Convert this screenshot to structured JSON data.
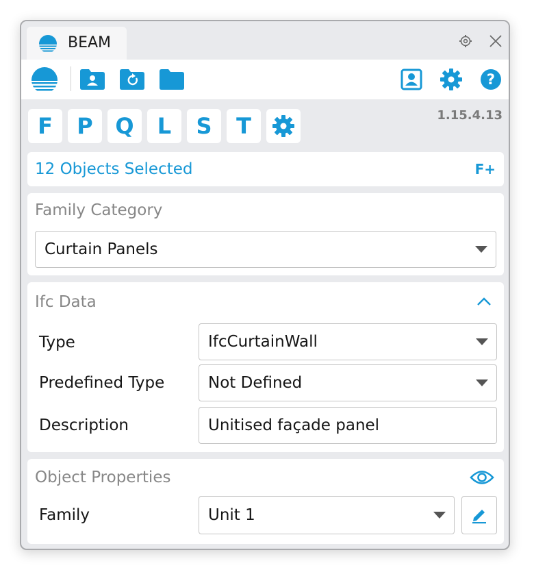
{
  "window": {
    "tab_title": "BEAM",
    "version": "1.15.4.13"
  },
  "toolbar": {
    "left": [
      "beam-logo",
      "user-folder-icon",
      "refresh-folder-icon",
      "folder-icon"
    ],
    "right": [
      "contact-icon",
      "settings-icon",
      "help-icon"
    ]
  },
  "letters": [
    "F",
    "P",
    "Q",
    "L",
    "S",
    "T"
  ],
  "selection": {
    "text": "12 Objects Selected",
    "action": "F+"
  },
  "family_category": {
    "title": "Family Category",
    "value": "Curtain Panels"
  },
  "ifc": {
    "title": "Ifc Data",
    "type_label": "Type",
    "type_value": "IfcCurtainWall",
    "predef_label": "Predefined Type",
    "predef_value": "Not Defined",
    "desc_label": "Description",
    "desc_value": "Unitised façade panel"
  },
  "object_props": {
    "title": "Object Properties",
    "family_label": "Family",
    "family_value": "Unit 1"
  },
  "colors": {
    "accent": "#1798d6",
    "bg": "#e9eaed"
  }
}
